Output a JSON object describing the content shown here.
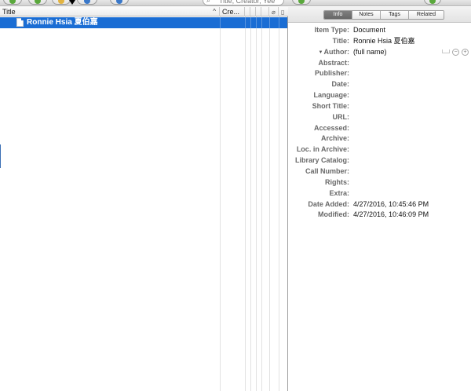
{
  "toolbar": {
    "search_placeholder": "Title, Creator, Yee"
  },
  "items": {
    "columns": [
      {
        "label": "Title"
      },
      {
        "label": "Cre..."
      }
    ],
    "rows": [
      {
        "title": "Ronnie Hsia 夏伯嘉",
        "selected": true
      }
    ]
  },
  "detail": {
    "tabs": [
      {
        "label": "Info",
        "active": true
      },
      {
        "label": "Notes",
        "active": false
      },
      {
        "label": "Tags",
        "active": false
      },
      {
        "label": "Related",
        "active": false
      }
    ],
    "fields": [
      {
        "label": "Item Type:",
        "value": "Document"
      },
      {
        "label": "Title:",
        "value": "Ronnie Hsia 夏伯嘉"
      },
      {
        "label": "Author:",
        "value": "(full name)"
      },
      {
        "label": "Abstract:",
        "value": ""
      },
      {
        "label": "Publisher:",
        "value": ""
      },
      {
        "label": "Date:",
        "value": ""
      },
      {
        "label": "Language:",
        "value": ""
      },
      {
        "label": "Short Title:",
        "value": ""
      },
      {
        "label": "URL:",
        "value": ""
      },
      {
        "label": "Accessed:",
        "value": ""
      },
      {
        "label": "Archive:",
        "value": ""
      },
      {
        "label": "Loc. in Archive:",
        "value": ""
      },
      {
        "label": "Library Catalog:",
        "value": ""
      },
      {
        "label": "Call Number:",
        "value": ""
      },
      {
        "label": "Rights:",
        "value": ""
      },
      {
        "label": "Extra:",
        "value": ""
      },
      {
        "label": "Date Added:",
        "value": "4/27/2016, 10:45:46 PM"
      },
      {
        "label": "Modified:",
        "value": "4/27/2016, 10:46:09 PM"
      }
    ],
    "creator_buttons": {
      "minus": "−",
      "plus": "+"
    }
  },
  "icons": {
    "search": "magnifier-icon",
    "document": "document-icon",
    "sort": "sort-ascending-icon"
  },
  "colors": {
    "selection": "#1a6dd4",
    "active_tab": "#737373"
  }
}
